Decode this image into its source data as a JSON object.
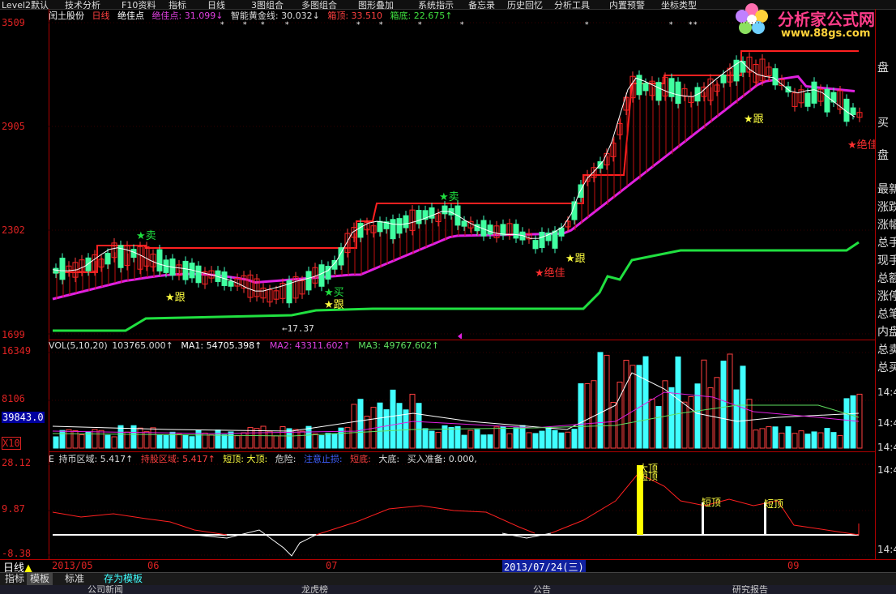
{
  "menu": [
    "Level2默认",
    "技术分析",
    "F10资料",
    "指标",
    "日线",
    "3图组合",
    "多图组合",
    "图形叠加",
    "系统指示",
    "备忘录",
    "历史回忆",
    "分析工具",
    "内置预警",
    "坐标类型"
  ],
  "logo": {
    "text": "分析家公式网",
    "url": "www.88gs.com"
  },
  "main_header": {
    "stock": "闰土股份",
    "period": "日线",
    "indicator": "绝佳点",
    "juejia_label": "绝佳点: 31.099↓",
    "gold_label": "智能黄金线: 30.032↓",
    "box_top_label": "箱顶: 33.510",
    "box_bottom_label": "箱底: 22.675↑"
  },
  "main_axis": [
    "3509",
    "2905",
    "2302",
    "1699"
  ],
  "vol_header": {
    "name": "VOL(5,10,20)",
    "value": "103765.000↑",
    "ma1": "MA1: 54705.398↑",
    "ma2": "MA2: 43311.602↑",
    "ma3": "MA3: 49767.602↑"
  },
  "vol_axis": [
    "16349",
    "8106"
  ],
  "vol_current": "39843.0",
  "vol_unit": "X10",
  "ind_header": {
    "prefix": "E",
    "hold": "持币区域: 5.417↑",
    "buy": "持股区域: 5.417↑",
    "short_top": "短顶: 大顶:",
    "danger": "危险:",
    "stop": "注意止损:",
    "short_bottom": "短底:",
    "big_bottom": "大底:",
    "buy_ready": "买入准备: 0.000,"
  },
  "ind_axis": [
    "28.12",
    "9.87",
    "-8.38"
  ],
  "date_axis": {
    "period": "日线",
    "dates": [
      "2013/05",
      "06",
      "07",
      "09"
    ],
    "cursor_date": "2013/07/24(三)"
  },
  "right_panel": [
    "盘",
    "买",
    "盘",
    "最新",
    "涨跌",
    "涨幅",
    "总手",
    "现手",
    "总额",
    "涨停",
    "总笔",
    "内盘",
    "总卖",
    "总买",
    "14:4",
    "14:4",
    "14:4",
    "14:4",
    "14:4"
  ],
  "tabs": [
    "指标",
    "模板",
    "标准",
    "存为模板"
  ],
  "bottom_items": [
    "公司新闻",
    "龙虎榜",
    "公告",
    "研究报告"
  ],
  "annotations": {
    "sell": "卖",
    "buy": "买",
    "follow": "跟",
    "best": "绝佳",
    "low_value": "17.37",
    "big_top": "大顶",
    "short_top": "短顶"
  },
  "colors": {
    "red": "#ff2020",
    "magenta": "#e020e0",
    "green": "#20e040",
    "cyan": "#40ffff",
    "yellow": "#ffff00",
    "white": "#ffffff"
  }
}
